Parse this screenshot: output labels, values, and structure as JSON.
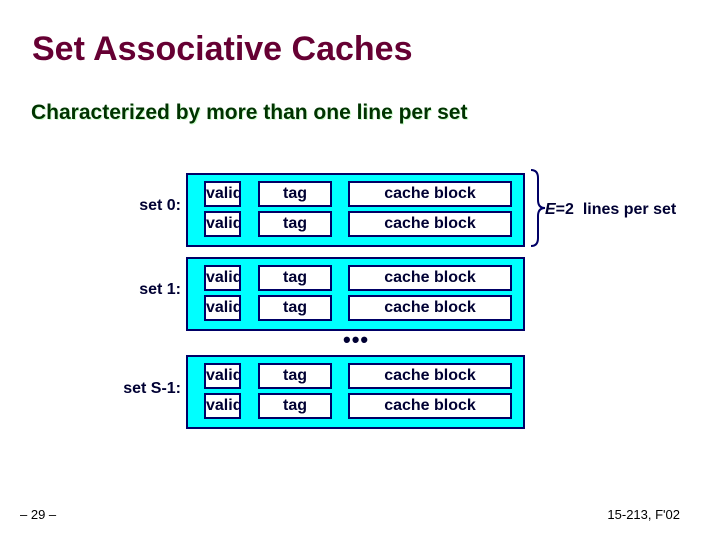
{
  "slide": {
    "title": "Set Associative Caches",
    "subtitle": "Characterized by more than one line per set",
    "sets": [
      {
        "label": "set 0:",
        "lines": [
          {
            "valid": "valid",
            "tag": "tag",
            "block": "cache block"
          },
          {
            "valid": "valid",
            "tag": "tag",
            "block": "cache block"
          }
        ]
      },
      {
        "label": "set 1:",
        "lines": [
          {
            "valid": "valid",
            "tag": "tag",
            "block": "cache block"
          },
          {
            "valid": "valid",
            "tag": "tag",
            "block": "cache block"
          }
        ]
      },
      {
        "label": "set S-1:",
        "lines": [
          {
            "valid": "valid",
            "tag": "tag",
            "block": "cache block"
          },
          {
            "valid": "valid",
            "tag": "tag",
            "block": "cache block"
          }
        ]
      }
    ],
    "ellipsis": "•••",
    "brace_annotation": {
      "variable": "E",
      "value_text": "=2",
      "suffix": "  lines per set"
    },
    "footer": {
      "page_number": "– 29 –",
      "course": "15-213, F'02"
    },
    "colors": {
      "title": "#660033",
      "subtitle": "#003300",
      "set_fill": "#00ffff",
      "border": "#000066",
      "text": "#000033"
    }
  }
}
